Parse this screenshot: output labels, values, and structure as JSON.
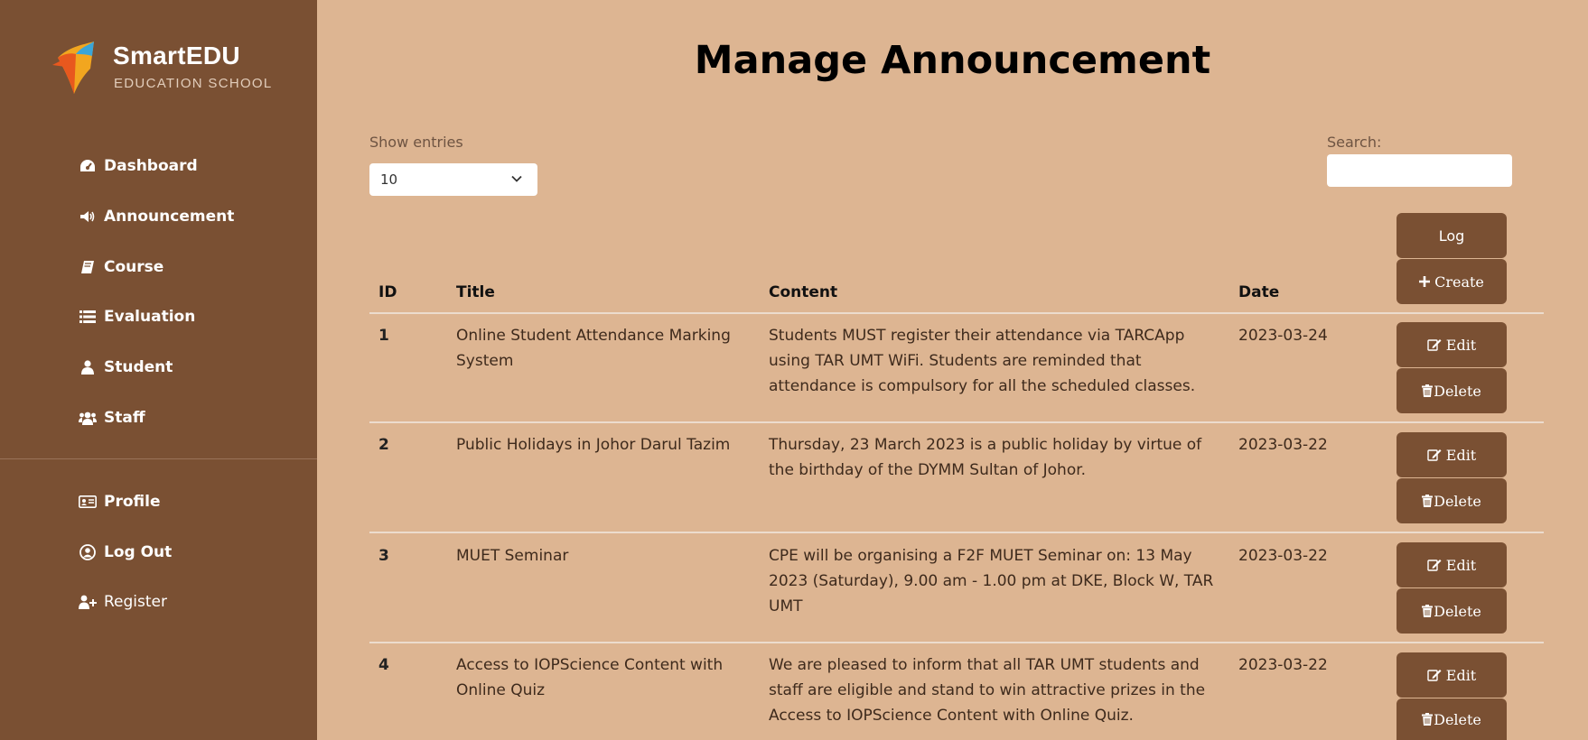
{
  "brand": {
    "name": "SmartEDU",
    "tagline": "EDUCATION SCHOOL"
  },
  "sidebar": {
    "items": [
      {
        "label": "Dashboard",
        "icon": "dashboard-icon"
      },
      {
        "label": "Announcement",
        "icon": "megaphone-icon"
      },
      {
        "label": "Course",
        "icon": "book-icon"
      },
      {
        "label": "Evaluation",
        "icon": "list-icon"
      },
      {
        "label": "Student",
        "icon": "user-icon"
      },
      {
        "label": "Staff",
        "icon": "users-icon"
      }
    ],
    "bottom_items": [
      {
        "label": "Profile",
        "icon": "id-card-icon"
      },
      {
        "label": "Log Out",
        "icon": "user-circle-icon"
      },
      {
        "label": "Register",
        "icon": "user-plus-icon"
      }
    ]
  },
  "main": {
    "title": "Manage Announcement",
    "show_entries_label": "Show entries",
    "entries_value": "10",
    "search_label": "Search:",
    "search_value": "",
    "log_label": "Log",
    "create_label": "Create",
    "edit_label": "Edit",
    "delete_label": "Delete"
  },
  "table": {
    "columns": [
      "ID",
      "Title",
      "Content",
      "Date"
    ],
    "rows": [
      {
        "id": "1",
        "title": "Online Student Attendance Marking System",
        "content": "Students MUST register their attendance via TARCApp using TAR UMT WiFi. Students are reminded that attendance is compulsory for all the scheduled classes.",
        "date": "2023-03-24"
      },
      {
        "id": "2",
        "title": "Public Holidays in Johor Darul Tazim",
        "content": "Thursday, 23 March 2023 is a public holiday by virtue of the birthday of the DYMM Sultan of Johor.",
        "date": "2023-03-22"
      },
      {
        "id": "3",
        "title": "MUET Seminar",
        "content": "CPE will be organising a F2F MUET Seminar on: 13 May 2023 (Saturday), 9.00 am - 1.00 pm at DKE, Block W, TAR UMT",
        "date": "2023-03-22"
      },
      {
        "id": "4",
        "title": "Access to IOPScience Content with Online Quiz",
        "content": "We are pleased to inform that all TAR UMT students and staff are eligible and stand to win attractive prizes in the Access to IOPScience Content with Online Quiz.",
        "date": "2023-03-22"
      }
    ]
  },
  "colors": {
    "sidebar": "#7a5033",
    "background": "#ddb592",
    "button": "#7a5033"
  }
}
